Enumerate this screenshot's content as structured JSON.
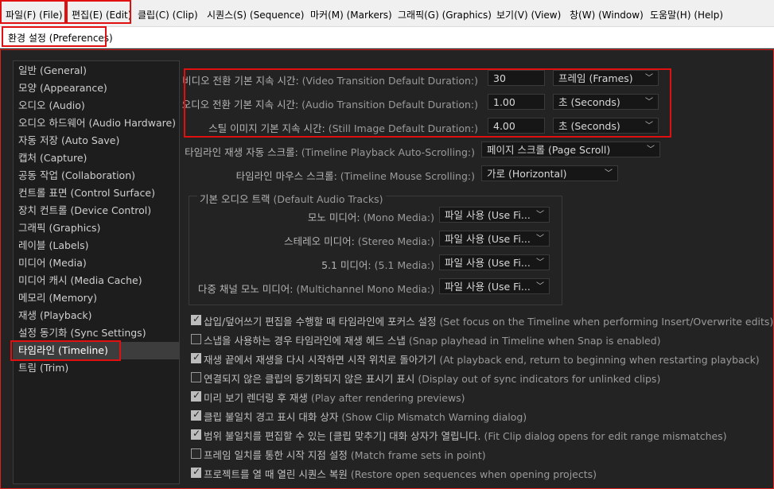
{
  "menubar": {
    "items": [
      {
        "label": "파일(F) (File)"
      },
      {
        "label": "편집(E) (Edit)"
      },
      {
        "label": "클립(C) (Clip)"
      },
      {
        "label": "시퀀스(S) (Sequence)"
      },
      {
        "label": "마커(M) (Markers)"
      },
      {
        "label": "그래픽(G) (Graphics)"
      },
      {
        "label": "보기(V) (View)"
      },
      {
        "label": "창(W) (Window)"
      },
      {
        "label": "도움말(H) (Help)"
      }
    ]
  },
  "dialog": {
    "title": "환경 설정 (Preferences)"
  },
  "sidebar": {
    "items": [
      {
        "label": "일반 (General)"
      },
      {
        "label": "모양 (Appearance)"
      },
      {
        "label": "오디오 (Audio)"
      },
      {
        "label": "오디오 하드웨어 (Audio Hardware)"
      },
      {
        "label": "자동 저장 (Auto Save)"
      },
      {
        "label": "캡처 (Capture)"
      },
      {
        "label": "공동 작업 (Collaboration)"
      },
      {
        "label": "컨트롤 표면 (Control Surface)"
      },
      {
        "label": "장치 컨트롤 (Device Control)"
      },
      {
        "label": "그래픽 (Graphics)"
      },
      {
        "label": "레이블 (Labels)"
      },
      {
        "label": "미디어 (Media)"
      },
      {
        "label": "미디어 캐시 (Media Cache)"
      },
      {
        "label": "메모리 (Memory)"
      },
      {
        "label": "재생 (Playback)"
      },
      {
        "label": "설정 동기화 (Sync Settings)"
      },
      {
        "label": "타임라인 (Timeline)"
      },
      {
        "label": "트림 (Trim)"
      }
    ],
    "selected": "타임라인 (Timeline)"
  },
  "timeline": {
    "video_transition": {
      "label_ko": "비디오 전환 기본 지속 시간:",
      "label_en": "(Video Transition Default Duration:)",
      "value": "30",
      "unit": "프레임 (Frames)"
    },
    "audio_transition": {
      "label_ko": "오디오 전환 기본 지속 시간:",
      "label_en": "(Audio Transition Default Duration:)",
      "value": "1.00",
      "unit": "초 (Seconds)"
    },
    "still_image": {
      "label_ko": "스틸 이미지 기본 지속 시간:",
      "label_en": "(Still Image Default Duration:)",
      "value": "4.00",
      "unit": "초 (Seconds)"
    },
    "playback_scroll": {
      "label_ko": "타임라인 재생 자동 스크롤:",
      "label_en": "(Timeline Playback Auto-Scrolling:)",
      "value": "페이지 스크롤 (Page Scroll)"
    },
    "mouse_scroll": {
      "label_ko": "타임라인 마우스 스크롤:",
      "label_en": "(Timeline Mouse Scrolling:)",
      "value": "가로 (Horizontal)"
    },
    "default_audio_tracks": {
      "title_ko": "기본 오디오 트랙",
      "title_en": "(Default Audio Tracks)",
      "rows": [
        {
          "label_ko": "모노 미디어:",
          "label_en": "(Mono Media:)",
          "value": "파일 사용 (Use Fi..."
        },
        {
          "label_ko": "스테레오 미디어:",
          "label_en": "(Stereo Media:)",
          "value": "파일 사용 (Use Fi..."
        },
        {
          "label_ko": "5.1 미디어:",
          "label_en": "(5.1 Media:)",
          "value": "파일 사용 (Use Fi..."
        },
        {
          "label_ko": "다중 채널 모노 미디어:",
          "label_en": "(Multichannel Mono Media:)",
          "value": "파일 사용 (Use Fi..."
        }
      ]
    },
    "checkboxes": [
      {
        "label_ko": "삽입/덮어쓰기 편집을 수행할 때 타임라인에 포커스 설정",
        "label_en": "(Set focus on the Timeline when performing Insert/Overwrite edits)",
        "checked": true
      },
      {
        "label_ko": "스냅을 사용하는 경우 타임라인에 재생 헤드 스냅",
        "label_en": "(Snap playhead in Timeline when Snap is enabled)",
        "checked": false
      },
      {
        "label_ko": "재생 끝에서 재생을 다시 시작하면 시작 위치로 돌아가기",
        "label_en": "(At playback end, return to beginning when restarting playback)",
        "checked": true
      },
      {
        "label_ko": "연결되지 않은 클립의 동기화되지 않은 표시기 표시",
        "label_en": "(Display out of sync indicators for unlinked clips)",
        "checked": false
      },
      {
        "label_ko": "미리 보기 렌더링 후 재생",
        "label_en": "(Play after rendering previews)",
        "checked": true
      },
      {
        "label_ko": "클립 불일치 경고 표시 대화 상자",
        "label_en": "(Show Clip Mismatch Warning dialog)",
        "checked": true
      },
      {
        "label_ko": "범위 불일치를 편집할 수 있는 [클립 맞추기] 대화 상자가 열립니다.",
        "label_en": "(Fit Clip dialog opens for edit range mismatches)",
        "checked": true
      },
      {
        "label_ko": "프레임 일치를 통한 시작 지점 설정",
        "label_en": "(Match frame sets in point)",
        "checked": false
      },
      {
        "label_ko": "프로젝트를 열 때 열린 시퀀스 복원",
        "label_en": "(Restore open sequences when opening projects)",
        "checked": true
      }
    ]
  },
  "colors": {
    "highlight": "#e01010",
    "panel_bg": "#232323",
    "field_bg": "#161616"
  }
}
